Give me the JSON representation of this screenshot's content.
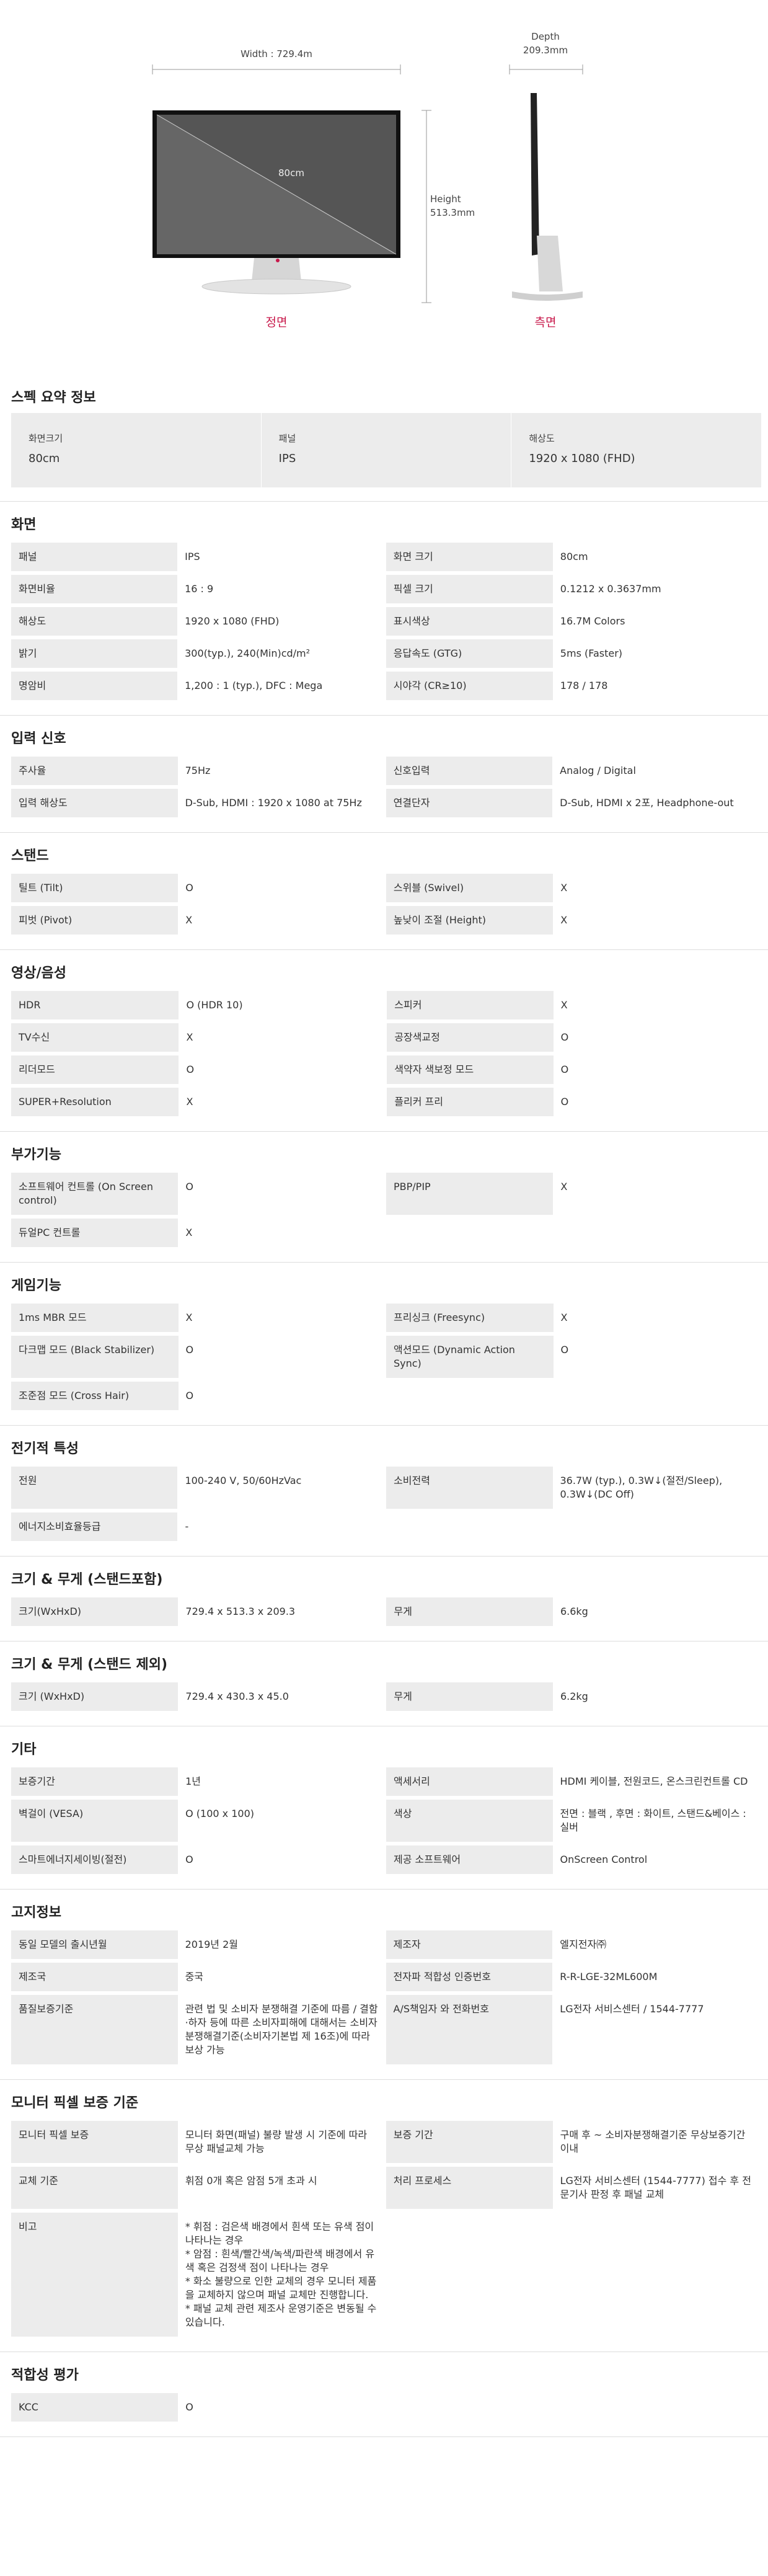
{
  "hero": {
    "width_label": "Width : 729.4m",
    "depth_label": "Depth",
    "depth_value": "209.3mm",
    "height_label": "Height",
    "height_value": "513.3mm",
    "diagonal_label": "80cm",
    "front_caption": "정면",
    "side_caption": "측면",
    "caption_color": "#c8194b"
  },
  "summary": {
    "title": "스펙 요약 정보",
    "items": [
      {
        "label": "화면크기",
        "value": "80cm"
      },
      {
        "label": "패널",
        "value": "IPS"
      },
      {
        "label": "해상도",
        "value": "1920 x 1080 (FHD)"
      }
    ]
  },
  "sections": [
    {
      "title": "화면",
      "rows": [
        [
          {
            "k": "패널",
            "v": "IPS"
          },
          {
            "k": "화면 크기",
            "v": "80cm"
          }
        ],
        [
          {
            "k": "화면비율",
            "v": "16 : 9"
          },
          {
            "k": "픽셀 크기",
            "v": "0.1212 x 0.3637mm"
          }
        ],
        [
          {
            "k": "해상도",
            "v": "1920 x 1080 (FHD)"
          },
          {
            "k": "표시색상",
            "v": "16.7M Colors"
          }
        ],
        [
          {
            "k": "밝기",
            "v": "300(typ.), 240(Min)cd/m²"
          },
          {
            "k": "응답속도 (GTG)",
            "v": "5ms (Faster)"
          }
        ],
        [
          {
            "k": "명암비",
            "v": "1,200 : 1 (typ.), DFC : Mega"
          },
          {
            "k": "시야각 (CR≥10)",
            "v": "178 / 178"
          }
        ]
      ]
    },
    {
      "title": "입력 신호",
      "rows": [
        [
          {
            "k": "주사율",
            "v": "75Hz"
          },
          {
            "k": "신호입력",
            "v": "Analog / Digital"
          }
        ],
        [
          {
            "k": "입력 해상도",
            "v": "D-Sub, HDMI : 1920 x 1080 at 75Hz"
          },
          {
            "k": "연결단자",
            "v": "D-Sub, HDMI x 2포, Headphone-out"
          }
        ]
      ]
    },
    {
      "title": "스탠드",
      "rows": [
        [
          {
            "k": "틸트 (Tilt)",
            "v": "O"
          },
          {
            "k": "스위블 (Swivel)",
            "v": "X"
          }
        ],
        [
          {
            "k": "피벗 (Pivot)",
            "v": "X"
          },
          {
            "k": "높낮이 조절 (Height)",
            "v": "X"
          }
        ]
      ]
    },
    {
      "title": "영상/음성",
      "rows": [
        [
          {
            "k": "HDR",
            "v": "O (HDR 10)"
          },
          {
            "k": "스피커",
            "v": "X"
          }
        ],
        [
          {
            "k": "TV수신",
            "v": "X"
          },
          {
            "k": "공장색교정",
            "v": "O"
          }
        ],
        [
          {
            "k": "리더모드",
            "v": "O"
          },
          {
            "k": "색약자 색보정 모드",
            "v": "O"
          }
        ],
        [
          {
            "k": "SUPER+Resolution",
            "v": "X"
          },
          {
            "k": "플리커 프리",
            "v": "O"
          }
        ]
      ]
    },
    {
      "title": "부가기능",
      "rows": [
        [
          {
            "k": "소프트웨어 컨트롤 (On Screen control)",
            "v": "O"
          },
          {
            "k": "PBP/PIP",
            "v": "X"
          }
        ],
        [
          {
            "k": "듀얼PC 컨트롤",
            "v": "X"
          },
          {
            "k": "",
            "v": ""
          }
        ]
      ]
    },
    {
      "title": "게임기능",
      "rows": [
        [
          {
            "k": "1ms MBR 모드",
            "v": "X"
          },
          {
            "k": "프리싱크 (Freesync)",
            "v": "X"
          }
        ],
        [
          {
            "k": "다크맵 모드 (Black Stabilizer)",
            "v": "O"
          },
          {
            "k": "액션모드 (Dynamic Action Sync)",
            "v": "O"
          }
        ],
        [
          {
            "k": "조준점 모드 (Cross Hair)",
            "v": "O"
          },
          {
            "k": "",
            "v": ""
          }
        ]
      ]
    },
    {
      "title": "전기적 특성",
      "rows": [
        [
          {
            "k": "전원",
            "v": "100-240 V, 50/60HzVac"
          },
          {
            "k": "소비전력",
            "v": "36.7W (typ.), 0.3W↓(절전/Sleep), 0.3W↓(DC Off)"
          }
        ],
        [
          {
            "k": "에너지소비효율등급",
            "v": "-"
          },
          {
            "k": "",
            "v": ""
          }
        ]
      ]
    },
    {
      "title": "크기 & 무게 (스탠드포함)",
      "rows": [
        [
          {
            "k": "크기(WxHxD)",
            "v": "729.4 x 513.3 x 209.3"
          },
          {
            "k": "무게",
            "v": "6.6kg"
          }
        ]
      ]
    },
    {
      "title": "크기 & 무게 (스탠드 제외)",
      "rows": [
        [
          {
            "k": "크기 (WxHxD)",
            "v": "729.4 x 430.3 x 45.0"
          },
          {
            "k": "무게",
            "v": "6.2kg"
          }
        ]
      ]
    },
    {
      "title": "기타",
      "rows": [
        [
          {
            "k": "보증기간",
            "v": "1년"
          },
          {
            "k": "액세서리",
            "v": "HDMI 케이블, 전원코드, 온스크린컨트롤 CD"
          }
        ],
        [
          {
            "k": "벽걸이 (VESA)",
            "v": "O (100 x 100)"
          },
          {
            "k": "색상",
            "v": "전면 : 블랙 , 후면 : 화이트, 스탠드&베이스 : 실버"
          }
        ],
        [
          {
            "k": "스마트에너지세이빙(절전)",
            "v": "O"
          },
          {
            "k": "제공 소프트웨어",
            "v": "OnScreen Control"
          }
        ]
      ]
    },
    {
      "title": "고지정보",
      "rows": [
        [
          {
            "k": "동일 모델의 출시년월",
            "v": "2019년 2월"
          },
          {
            "k": "제조자",
            "v": "엘지전자㈜"
          }
        ],
        [
          {
            "k": "제조국",
            "v": "중국"
          },
          {
            "k": "전자파 적합성 인증번호",
            "v": "R-R-LGE-32ML600M"
          }
        ],
        [
          {
            "k": "품질보증기준",
            "v": "관련 법 및 소비자 분쟁해결 기준에 따름 / 결함·하자 등에 따른 소비자피해에 대해서는 소비자분쟁해결기준(소비자기본법 제 16조)에 따라 보상 가능"
          },
          {
            "k": "A/S책임자 와 전화번호",
            "v": "LG전자 서비스센터 / 1544-7777"
          }
        ]
      ]
    },
    {
      "title": "모니터 픽셀 보증 기준",
      "rows": [
        [
          {
            "k": "모니터 픽셀 보증",
            "v": "모니터 화면(패널) 불량 발생 시 기준에 따라 무상 패널교체 가능"
          },
          {
            "k": "보증 기간",
            "v": "구매 후 ~ 소비자분쟁해결기준 무상보증기간 이내"
          }
        ],
        [
          {
            "k": "교체 기준",
            "v": "휘점 0개 혹은 암점 5개 초과 시"
          },
          {
            "k": "처리 프로세스",
            "v": "LG전자 서비스센터 (1544-7777) 접수 후 전문기사 판정 후 패널 교체"
          }
        ],
        [
          {
            "k": "비고",
            "v": "* 휘점 : 검은색 배경에서 흰색 또는 유색 점이 나타나는 경우\n* 암점 : 흰색/빨간색/녹색/파란색 배경에서 유색 혹은 검정색 점이 나타나는 경우\n* 화소 불량으로 인한 교체의 경우 모니터 제품을 교체하지 않으며 패널 교체만 진행합니다.\n* 패널 교체 관련 제조사 운영기준은 변동될 수 있습니다."
          },
          {
            "k": "",
            "v": ""
          }
        ]
      ]
    },
    {
      "title": "적합성 평가",
      "rows": [
        [
          {
            "k": "KCC",
            "v": "O"
          },
          {
            "k": "",
            "v": ""
          }
        ]
      ]
    }
  ]
}
